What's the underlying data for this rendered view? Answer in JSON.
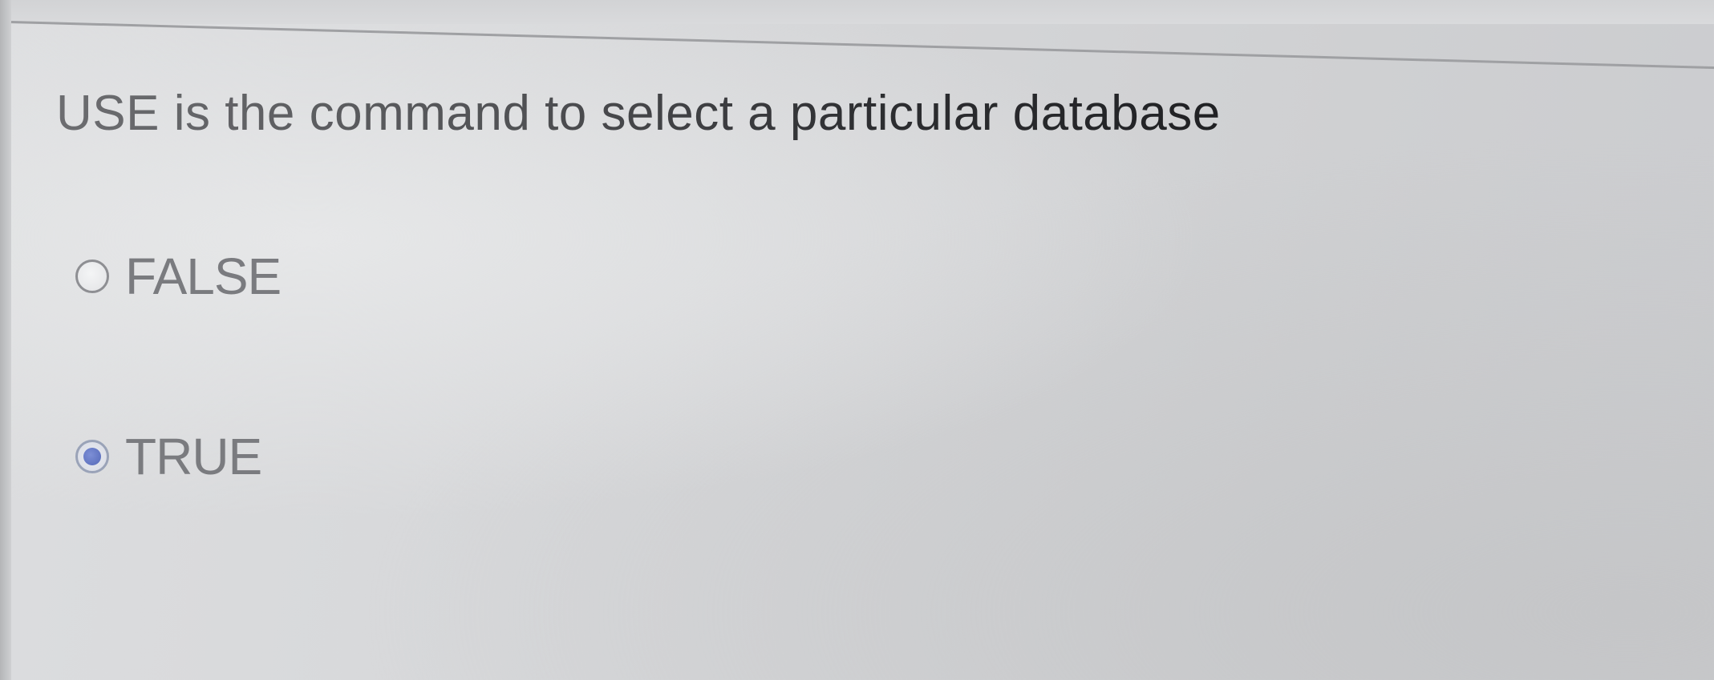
{
  "question": {
    "text": "USE is the command to select a particular database",
    "options": [
      {
        "label": "FALSE",
        "selected": false
      },
      {
        "label": "TRUE",
        "selected": true
      }
    ]
  },
  "colors": {
    "radio_selected": "#5468b8",
    "text": "#2d2e31",
    "background": "#d6d7d9"
  },
  "icons": {
    "unselected": "radio-unchecked-icon",
    "selected": "radio-checked-icon"
  }
}
